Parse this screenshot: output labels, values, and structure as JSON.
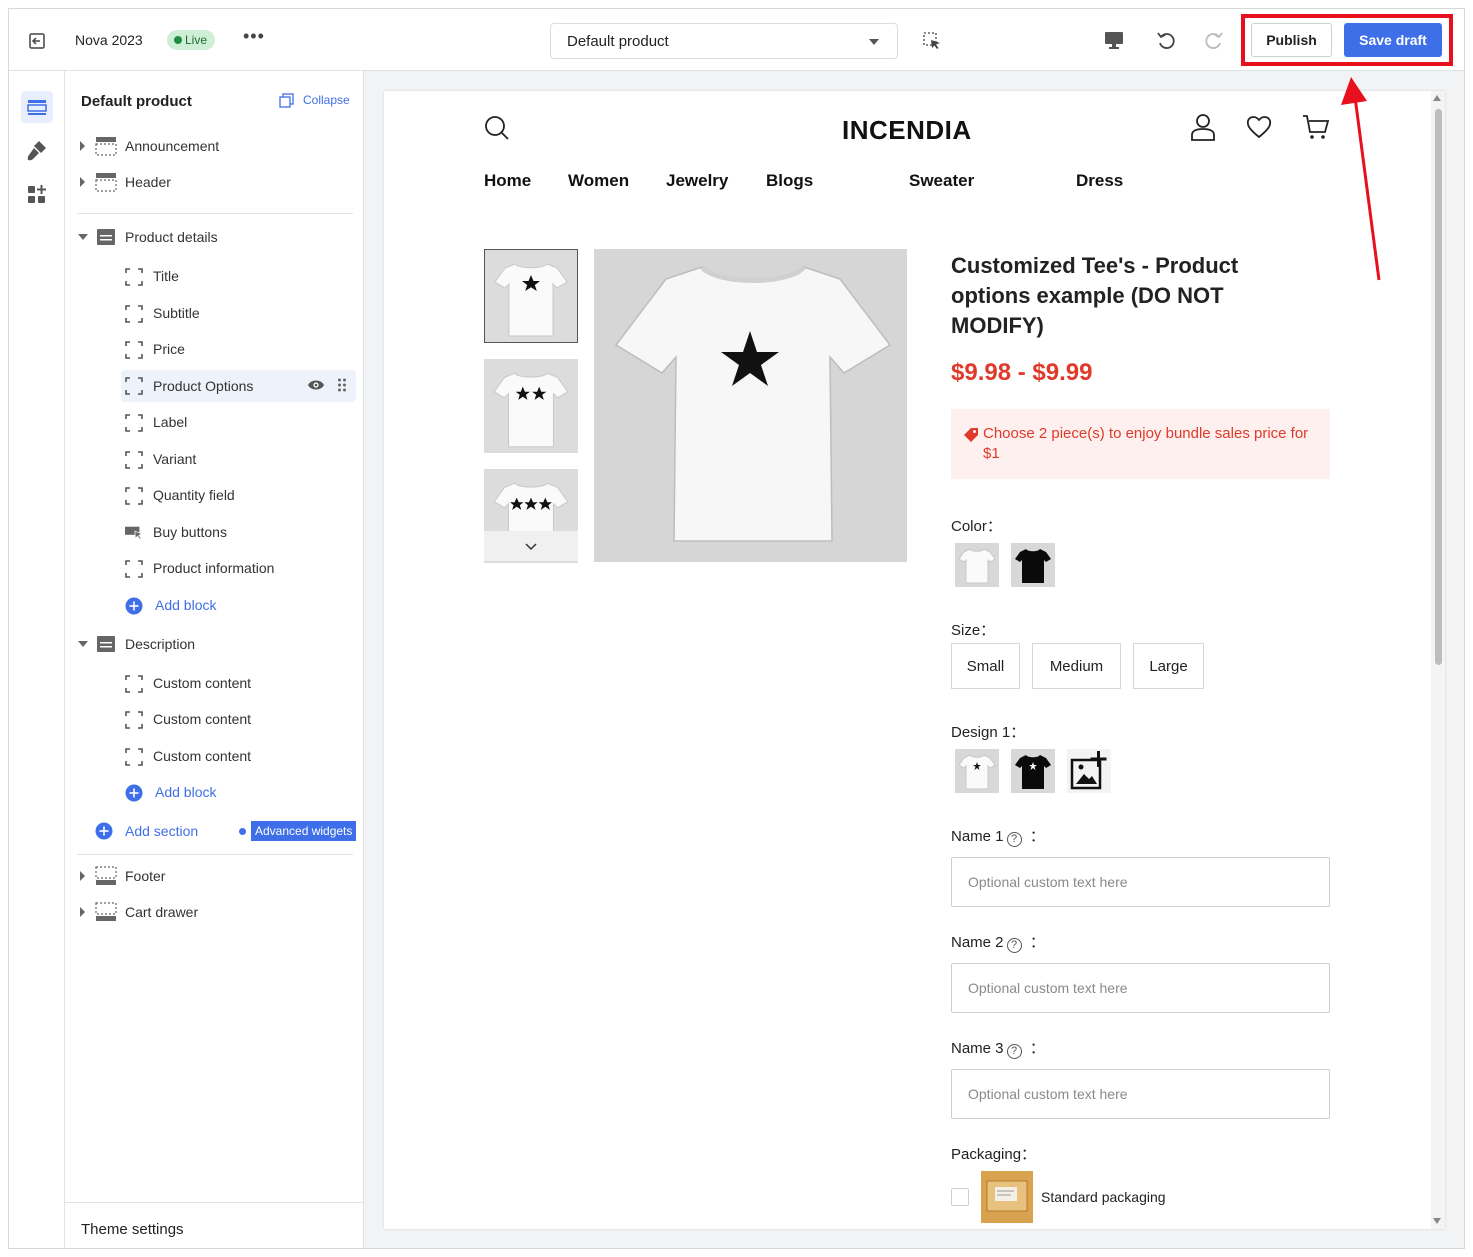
{
  "topbar": {
    "store_name": "Nova 2023",
    "live_badge": "Live",
    "more": "•••",
    "page_select": "Default product",
    "publish_label": "Publish",
    "save_draft_label": "Save draft"
  },
  "sidebar": {
    "title": "Default product",
    "collapse_label": "Collapse",
    "announcement": "Announcement",
    "header": "Header",
    "product_details": "Product details",
    "blocks": [
      "Title",
      "Subtitle",
      "Price",
      "Product Options",
      "Label",
      "Variant",
      "Quantity field",
      "Buy buttons",
      "Product information"
    ],
    "add_block": "Add block",
    "description": "Description",
    "description_blocks": [
      "Custom content",
      "Custom content",
      "Custom content"
    ],
    "add_block_2": "Add block",
    "add_section": "Add section",
    "advanced_widgets": "Advanced widgets",
    "footer": "Footer",
    "cart_drawer": "Cart drawer",
    "theme_settings": "Theme settings"
  },
  "preview": {
    "brand": "INCENDIA",
    "nav": [
      "Home",
      "Women",
      "Jewelry",
      "Blogs",
      "Sweater",
      "Dress"
    ],
    "product_title": "Customized Tee's - Product options example (DO NOT MODIFY)",
    "price": "$9.98 - $9.99",
    "bundle_text": "Choose 2 piece(s) to enjoy bundle sales price for $1",
    "color_label": "Color：",
    "size_label": "Size：",
    "sizes": [
      "Small",
      "Medium",
      "Large"
    ],
    "design_label": "Design 1：",
    "name1_label": "Name 1",
    "name2_label": "Name 2",
    "name3_label": "Name 3",
    "colon": "：",
    "help_glyph": "?",
    "placeholder": "Optional custom text here",
    "packaging_label": "Packaging：",
    "packaging_option": "Standard packaging"
  },
  "colors": {
    "accent": "#3f6fe8",
    "highlight": "#e8101d",
    "price": "#e03a2a"
  }
}
